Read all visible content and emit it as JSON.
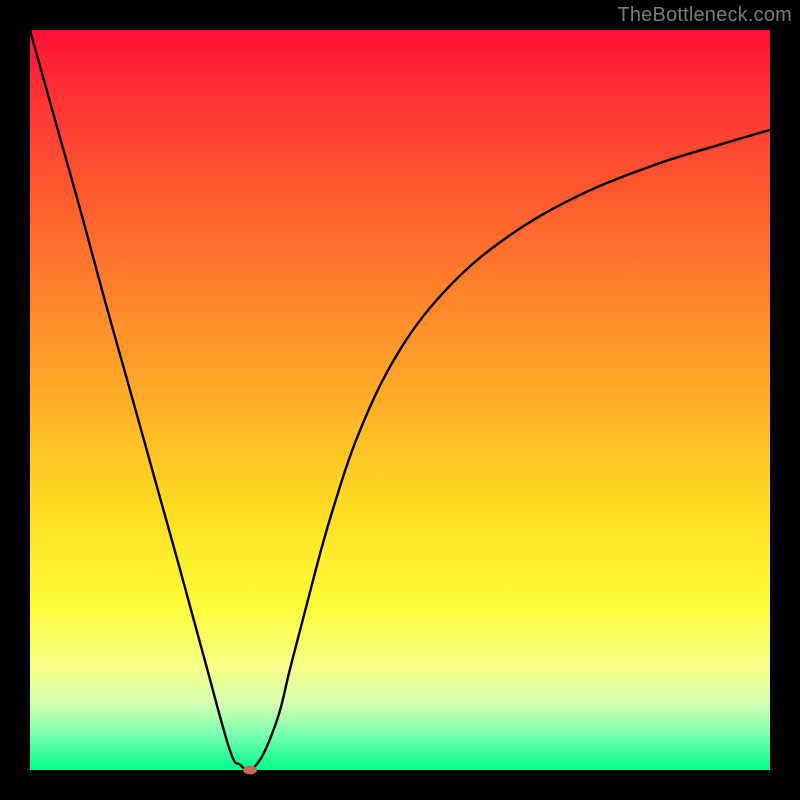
{
  "watermark": "TheBottleneck.com",
  "chart_data": {
    "type": "line",
    "title": "",
    "xlabel": "",
    "ylabel": "",
    "xlim": [
      0,
      100
    ],
    "ylim": [
      0,
      100
    ],
    "grid": false,
    "background_gradient_stops": [
      {
        "pos": 0,
        "color": "#ff1034"
      },
      {
        "pos": 8,
        "color": "#ff2f34"
      },
      {
        "pos": 22,
        "color": "#ff5a2f"
      },
      {
        "pos": 38,
        "color": "#ff8a2b"
      },
      {
        "pos": 52,
        "color": "#ffb427"
      },
      {
        "pos": 66,
        "color": "#ffe023"
      },
      {
        "pos": 78,
        "color": "#fdfd3b"
      },
      {
        "pos": 86,
        "color": "#f6ff88"
      },
      {
        "pos": 91,
        "color": "#d5ffb0"
      },
      {
        "pos": 95,
        "color": "#7dffb1"
      },
      {
        "pos": 100,
        "color": "#00ff8c"
      }
    ],
    "series": [
      {
        "name": "bottleneck-curve",
        "x": [
          0.0,
          3.4,
          6.8,
          10.1,
          13.5,
          16.9,
          20.3,
          23.6,
          27.0,
          28.4,
          29.7,
          31.1,
          32.4,
          33.8,
          35.1,
          37.2,
          40.5,
          44.6,
          50.0,
          56.8,
          64.9,
          74.3,
          84.5,
          93.2,
          100.0
        ],
        "y": [
          100.0,
          87.8,
          75.7,
          63.5,
          51.4,
          39.2,
          27.0,
          14.9,
          2.7,
          0.7,
          0.0,
          1.4,
          4.1,
          8.1,
          13.5,
          21.6,
          33.8,
          45.9,
          56.8,
          65.5,
          72.3,
          77.7,
          81.8,
          84.5,
          86.5
        ]
      }
    ],
    "marker": {
      "x": 29.7,
      "y": 0.0,
      "color": "#c76a5a"
    }
  }
}
